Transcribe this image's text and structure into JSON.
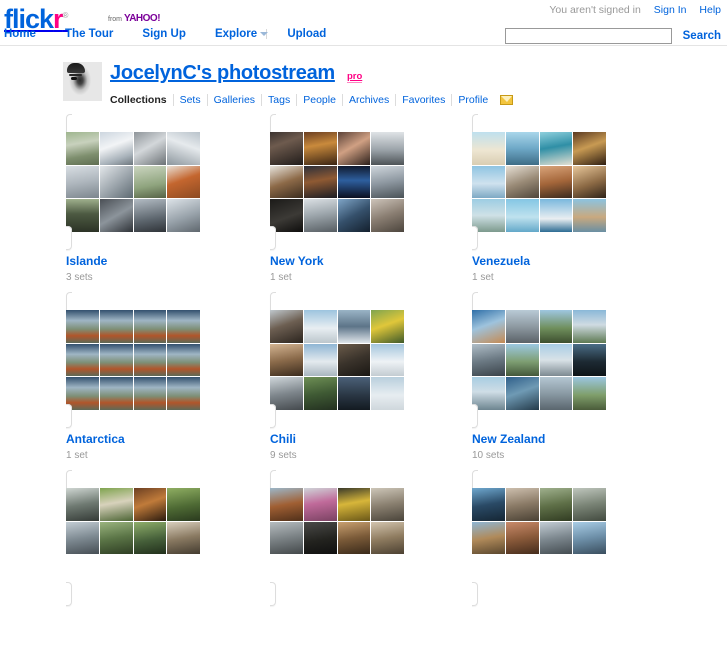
{
  "header": {
    "logo": {
      "part_blue": "flick",
      "part_pink": "r",
      "registered": "®"
    },
    "from_label": "from",
    "yahoo_label": "YAHOO!",
    "signed_in_status": "You aren't signed in",
    "sign_in_label": "Sign In",
    "help_label": "Help",
    "nav": [
      {
        "label": "Home"
      },
      {
        "label": "The Tour"
      },
      {
        "label": "Sign Up"
      },
      {
        "label": "Explore"
      },
      {
        "label": "Upload"
      }
    ],
    "search": {
      "value": "",
      "placeholder": "",
      "button_label": "Search"
    }
  },
  "profile": {
    "title": "JocelynC's photostream",
    "pro_badge": "pro",
    "avatar_icon": "user-avatar-photo",
    "tabs": [
      {
        "label": "Collections",
        "active": true
      },
      {
        "label": "Sets",
        "active": false
      },
      {
        "label": "Galleries",
        "active": false
      },
      {
        "label": "Tags",
        "active": false
      },
      {
        "label": "People",
        "active": false
      },
      {
        "label": "Archives",
        "active": false
      },
      {
        "label": "Favorites",
        "active": false
      },
      {
        "label": "Profile",
        "active": false
      }
    ],
    "mail_icon": "envelope-icon"
  },
  "collections": [
    {
      "name": "Islande",
      "count": "3 sets",
      "thumb_class": "t-veh",
      "repeat": false
    },
    {
      "name": "New York",
      "count": "1 set",
      "thumb_class": "t-ny",
      "repeat": false
    },
    {
      "name": "Venezuela",
      "count": "1 set",
      "thumb_class": "t-vz",
      "repeat": false
    },
    {
      "name": "Antarctica",
      "count": "1 set",
      "thumb_class": "t-ant",
      "repeat": true
    },
    {
      "name": "Chili",
      "count": "9 sets",
      "thumb_class": "t-ch",
      "repeat": false
    },
    {
      "name": "New Zealand",
      "count": "10 sets",
      "thumb_class": "t-nz",
      "repeat": false
    },
    {
      "name": "",
      "count": "",
      "thumb_class": "t-r3a",
      "repeat": false
    },
    {
      "name": "",
      "count": "",
      "thumb_class": "t-r3b",
      "repeat": false
    },
    {
      "name": "",
      "count": "",
      "thumb_class": "t-r3c",
      "repeat": false
    }
  ],
  "colors": {
    "link_blue": "#0063dc",
    "brand_pink": "#ff0084",
    "muted_gray": "#999999",
    "card_border": "#dddddd"
  }
}
